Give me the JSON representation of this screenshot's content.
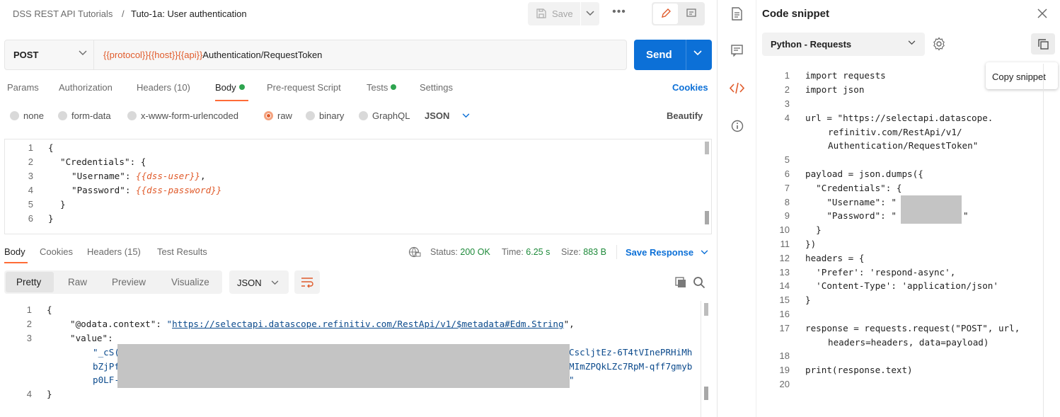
{
  "breadcrumb": {
    "collection": "DSS REST API Tutorials",
    "separator": "/",
    "request": "Tuto-1a: User authentication"
  },
  "toolbar": {
    "save_label": "Save",
    "more_label": "•••"
  },
  "request": {
    "method": "POST",
    "url_vars": [
      "{{protocol}}",
      "{{host}}",
      "{{api}}"
    ],
    "url_path": "Authentication/RequestToken",
    "send_label": "Send"
  },
  "request_tabs": {
    "params": "Params",
    "authorization": "Authorization",
    "headers": "Headers",
    "headers_count": "(10)",
    "body": "Body",
    "prescript": "Pre-request Script",
    "tests": "Tests",
    "settings": "Settings",
    "cookies": "Cookies"
  },
  "body_modes": {
    "none": "none",
    "form_data": "form-data",
    "urlencoded": "x-www-form-urlencoded",
    "raw": "raw",
    "binary": "binary",
    "graphql": "GraphQL",
    "format": "JSON",
    "beautify": "Beautify"
  },
  "request_body": {
    "line_numbers": [
      "1",
      "2",
      "3",
      "4",
      "5",
      "6"
    ],
    "l1": "{",
    "l2_key": "\"Credentials\"",
    "l2_rest": ": {",
    "l3_key": "\"Username\"",
    "l3_colon": ": ",
    "l3_val": "{{dss-user}}",
    "l3_end": ",",
    "l4_key": "\"Password\"",
    "l4_colon": ": ",
    "l4_val": "{{dss-password}}",
    "l5": "}",
    "l6": "}"
  },
  "response_tabs": {
    "body": "Body",
    "cookies": "Cookies",
    "headers": "Headers",
    "headers_count": "(15)",
    "test_results": "Test Results",
    "status_label": "Status:",
    "status_value": "200 OK",
    "time_label": "Time:",
    "time_value": "6.25 s",
    "size_label": "Size:",
    "size_value": "883 B",
    "save_response": "Save Response"
  },
  "response_view": {
    "pretty": "Pretty",
    "raw": "Raw",
    "preview": "Preview",
    "visualize": "Visualize",
    "format": "JSON"
  },
  "response_body": {
    "line_numbers": [
      "1",
      "2",
      "3",
      "4"
    ],
    "l1": "{",
    "l2_key": "\"@odata.context\"",
    "l2_colon": ": ",
    "l2_q1": "\"",
    "l2_url": "https://selectapi.datascope.refinitiv.com/RestApi/v1/$metadata#Edm.String",
    "l2_q2": "\",",
    "l3_key": "\"value\"",
    "l3_colon": ":",
    "v1a": "\"_cS(",
    "v1b": "CscljtEz-6T4tVInePRHiMh",
    "v2a": "bZjPf",
    "v2b": "MImZPQkLZc7RpM-qff7gmyb",
    "v3a": "p0LF-",
    "v3b": "\"",
    "l4": "}"
  },
  "snippet": {
    "title": "Code snippet",
    "language": "Python - Requests",
    "tooltip": "Copy snippet",
    "line_numbers": [
      "1",
      "2",
      "3",
      "4",
      "5",
      "6",
      "7",
      "8",
      "9",
      "10",
      "11",
      "12",
      "13",
      "14",
      "15",
      "16",
      "17",
      "18",
      "19",
      "20"
    ],
    "l1": "import requests",
    "l2": "import json",
    "l4a": "url = \"https://selectapi.datascope.",
    "l4b": "refinitiv.com/RestApi/v1/",
    "l4c": "Authentication/RequestToken\"",
    "l6": "payload = json.dumps({",
    "l7": "  \"Credentials\": {",
    "l8": "    \"Username\": \"",
    "l9a": "    \"Password\": \"",
    "l9b": "\"",
    "l10": "  }",
    "l11": "})",
    "l12": "headers = {",
    "l13": "  'Prefer': 'respond-async',",
    "l14": "  'Content-Type': 'application/json'",
    "l15": "}",
    "l17a": "response = requests.request(\"POST\", url,",
    "l17b": "headers=headers, data=payload)",
    "l19": "print(response.text)"
  },
  "colors": {
    "accent_orange": "#ff6c37",
    "send_blue": "#0c70d7",
    "variable": "#e05b2b",
    "success_green": "#2ea44f"
  },
  "icons": [
    "save-icon",
    "chevron-down-icon",
    "more-icon",
    "pencil-icon",
    "document-icon",
    "comment-icon",
    "code-icon",
    "info-icon",
    "close-icon",
    "gear-icon",
    "copy-icon",
    "search-icon",
    "wrap-icon",
    "globe-icon"
  ]
}
